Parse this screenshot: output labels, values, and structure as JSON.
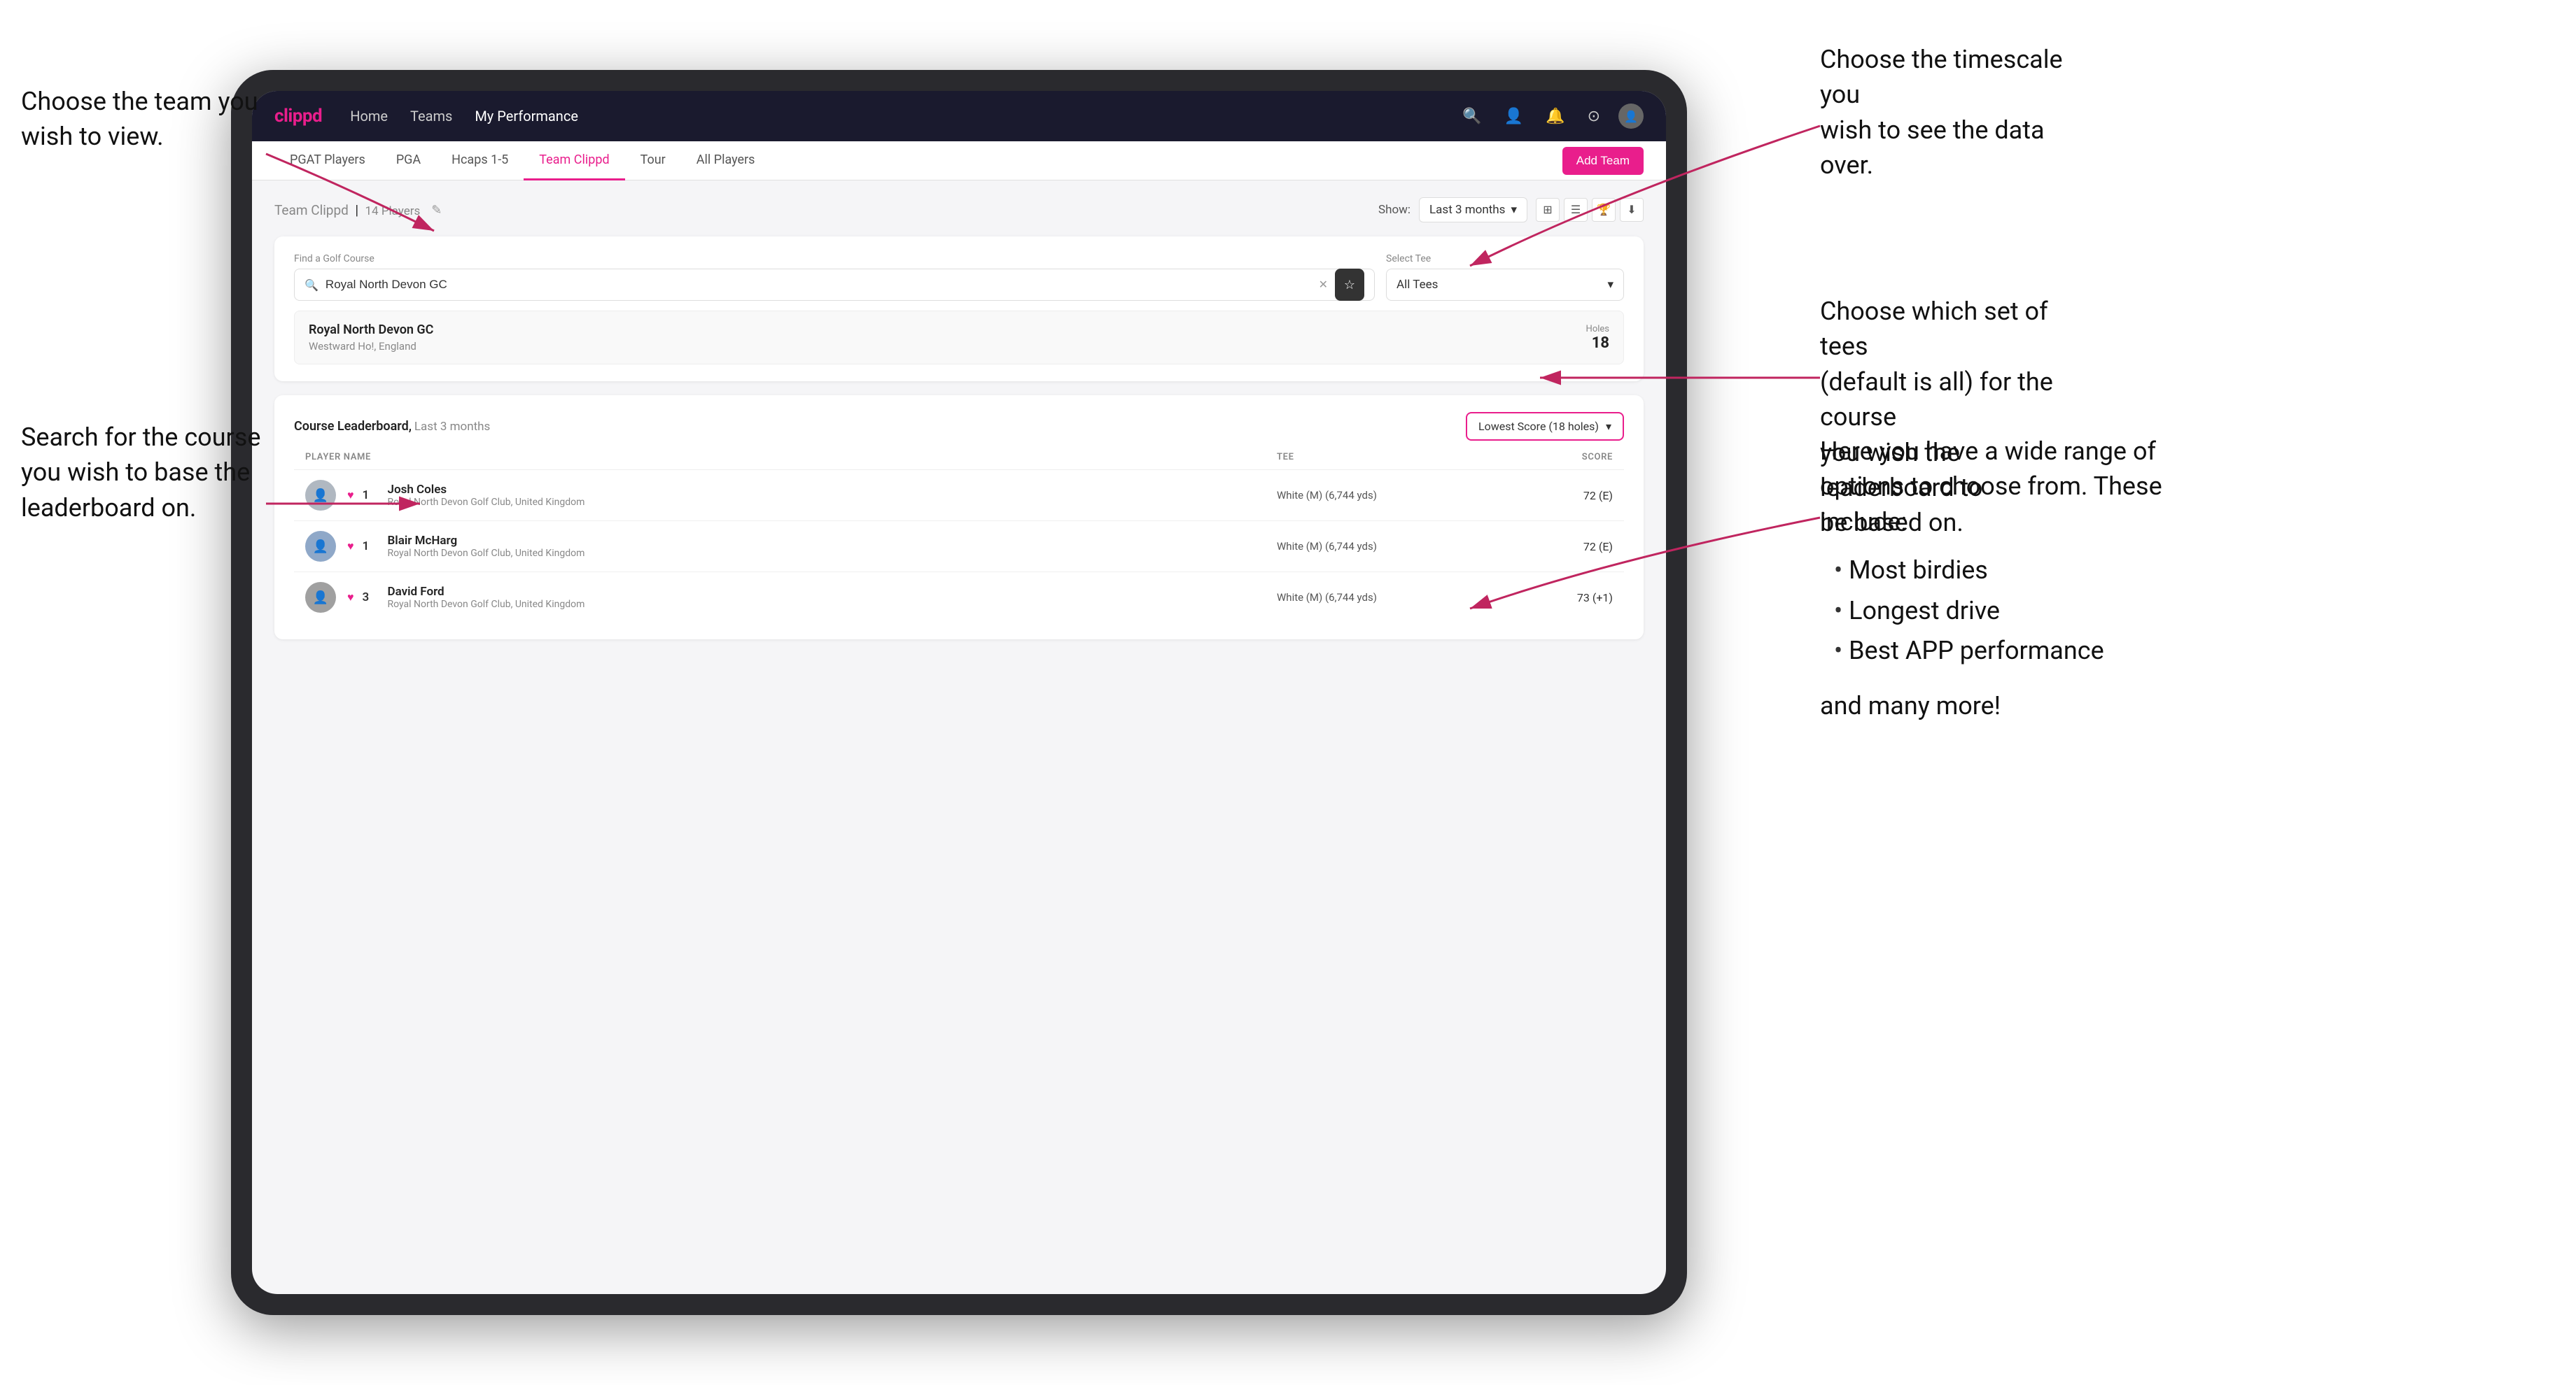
{
  "annotations": {
    "top_left": {
      "line1": "Choose the team you",
      "line2": "wish to view."
    },
    "mid_left": {
      "line1": "Search for the course",
      "line2": "you wish to base the",
      "line3": "leaderboard on."
    },
    "top_right": {
      "line1": "Choose the timescale you",
      "line2": "wish to see the data over."
    },
    "mid_right": {
      "line1": "Choose which set of tees",
      "line2": "(default is all) for the course",
      "line3": "you wish the leaderboard to",
      "line4": "be based on."
    },
    "bottom_right": {
      "intro": "Here you have a wide range of options to choose from. These include:",
      "bullets": [
        "Most birdies",
        "Longest drive",
        "Best APP performance"
      ],
      "and_more": "and many more!"
    }
  },
  "nav": {
    "logo": "clippd",
    "links": [
      {
        "label": "Home",
        "active": false
      },
      {
        "label": "Teams",
        "active": false
      },
      {
        "label": "My Performance",
        "active": true
      }
    ],
    "icons": [
      "search",
      "people",
      "bell",
      "settings",
      "account"
    ]
  },
  "sub_nav": {
    "tabs": [
      {
        "label": "PGAT Players",
        "active": false
      },
      {
        "label": "PGA",
        "active": false
      },
      {
        "label": "Hcaps 1-5",
        "active": false
      },
      {
        "label": "Team Clippd",
        "active": true
      },
      {
        "label": "Tour",
        "active": false
      },
      {
        "label": "All Players",
        "active": false
      }
    ],
    "add_team_label": "Add Team"
  },
  "team_header": {
    "name": "Team Clippd",
    "player_count": "14 Players",
    "show_label": "Show:",
    "show_value": "Last 3 months"
  },
  "golf_course_search": {
    "find_label": "Find a Golf Course",
    "search_value": "Royal North Devon GC",
    "select_tee_label": "Select Tee",
    "tee_value": "All Tees"
  },
  "course_result": {
    "name": "Royal North Devon GC",
    "location": "Westward Ho!, England",
    "holes_label": "Holes",
    "holes_value": "18"
  },
  "leaderboard": {
    "title": "Course Leaderboard,",
    "subtitle": "Last 3 months",
    "score_type": "Lowest Score (18 holes)",
    "columns": {
      "player_name": "PLAYER NAME",
      "tee": "TEE",
      "score": "SCORE"
    },
    "players": [
      {
        "rank": "1",
        "name": "Josh Coles",
        "club": "Royal North Devon Golf Club, United Kingdom",
        "tee": "White (M) (6,744 yds)",
        "score": "72 (E)"
      },
      {
        "rank": "1",
        "name": "Blair McHarg",
        "club": "Royal North Devon Golf Club, United Kingdom",
        "tee": "White (M) (6,744 yds)",
        "score": "72 (E)"
      },
      {
        "rank": "3",
        "name": "David Ford",
        "club": "Royal North Devon Golf Club, United Kingdom",
        "tee": "White (M) (6,744 yds)",
        "score": "73 (+1)"
      }
    ]
  }
}
